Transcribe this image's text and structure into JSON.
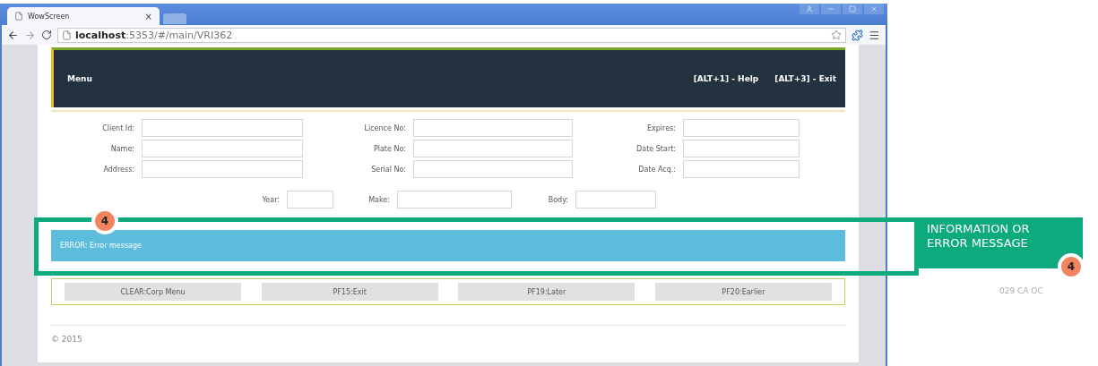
{
  "browser": {
    "tab_title": "WowScreen",
    "tab_close": "×",
    "url_host": "localhost",
    "url_path": ":5353/#/main/VRI362"
  },
  "header": {
    "title": "Menu",
    "shortcuts": [
      "[ALT+1] - Help",
      "[ALT+3] - Exit"
    ]
  },
  "form": {
    "columns": [
      {
        "fields": [
          {
            "label": "Client Id:"
          },
          {
            "label": "Name:"
          },
          {
            "label": "Address:"
          }
        ]
      },
      {
        "fields": [
          {
            "label": "Licence No:"
          },
          {
            "label": "Plate No:"
          },
          {
            "label": "Serial No:"
          }
        ]
      },
      {
        "fields": [
          {
            "label": "Expires:"
          },
          {
            "label": "Date Start:"
          },
          {
            "label": "Date Acq.:"
          }
        ]
      }
    ],
    "vehicle_row": [
      {
        "label": "Year:"
      },
      {
        "label": "Make:"
      },
      {
        "label": "Body:"
      }
    ]
  },
  "message": {
    "kind": "error",
    "text": "ERROR: Error message"
  },
  "function_keys": [
    "CLEAR:Corp Menu",
    "PF15:Exit",
    "PF19:Later",
    "PF20:Earlier"
  ],
  "footer": "© 2015",
  "annotation": {
    "badge": "4",
    "label": "INFORMATION OR ERROR MESSAGE",
    "badge_2": "4",
    "code": "029 CA OC"
  }
}
